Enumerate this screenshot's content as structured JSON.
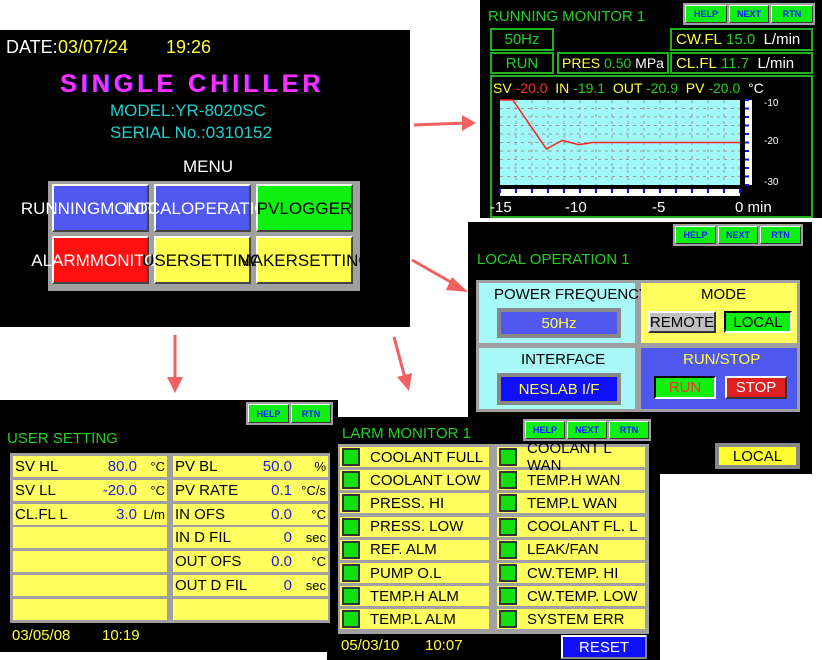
{
  "main_menu": {
    "date_label": "DATE:",
    "date": "03/07/24",
    "time": "19:26",
    "title": "SINGLE CHILLER",
    "model": "MODEL:YR-8020SC",
    "serial": "SERIAL No.:0310152",
    "menu_label": "MENU",
    "buttons": [
      {
        "l1": "RUNNING",
        "l2": "MONITOR",
        "color": "#5058f0"
      },
      {
        "l1": "LOCAL",
        "l2": "OPERATION",
        "color": "#5058f0"
      },
      {
        "l1": "PV",
        "l2": "LOGGER",
        "color": "#10f010"
      },
      {
        "l1": "ALARM",
        "l2": "MONITOR",
        "color": "#ff1010"
      },
      {
        "l1": "USER",
        "l2": "SETTING",
        "color": "#ffff50"
      },
      {
        "l1": "MAKER",
        "l2": "SETTING",
        "color": "#ffff50"
      }
    ]
  },
  "running_monitor": {
    "title": "RUNNING MONITOR 1",
    "help": "HELP",
    "next": "NEXT",
    "rtn": "RTN",
    "freq": "50Hz",
    "status": "RUN",
    "pres_label": "PRES",
    "pres_value": "0.50",
    "pres_unit": "MPa",
    "cwfl_label": "CW.FL",
    "cwfl_value": "15.0",
    "cwfl_unit": "L/min",
    "clfl_label": "CL.FL",
    "clfl_value": "11.7",
    "clfl_unit": "L/min",
    "sv_label": "SV",
    "sv": "-20.0",
    "in_label": "IN",
    "in": "-19.1",
    "out_label": "OUT",
    "out": "-20.9",
    "pv_label": "PV",
    "pv": "-20.0",
    "temp_unit": "°C"
  },
  "chart_data": {
    "type": "line",
    "x": [
      -15,
      -14.2,
      -12.1,
      -11.1,
      -10.1,
      -9.5,
      -9.3,
      0
    ],
    "y": [
      -10,
      -10,
      -21.5,
      -19.5,
      -20.5,
      -20.2,
      -20,
      -20
    ],
    "xlim": [
      -15,
      0
    ],
    "ylim": [
      -30,
      -10
    ],
    "xticks": [
      "-15",
      "-10",
      "-5",
      "0"
    ],
    "xunit": "min",
    "yticks": [
      "-10",
      "-20",
      "-30"
    ],
    "grid": true,
    "line_color": "#ff2020",
    "background": "#a0f8f8"
  },
  "local_operation": {
    "title": "LOCAL OPERATION 1",
    "help": "HELP",
    "next": "NEXT",
    "rtn": "RTN",
    "power_label": "POWER FREQUENCY",
    "power_value": "50Hz",
    "mode_label": "MODE",
    "remote": "REMOTE",
    "local": "LOCAL",
    "interface_label": "INTERFACE",
    "interface_value": "NESLAB I/F",
    "runstop_label": "RUN/STOP",
    "run": "RUN",
    "stop": "STOP",
    "local_indicator": "LOCAL"
  },
  "user_setting": {
    "title": "USER SETTING",
    "help": "HELP",
    "rtn": "RTN",
    "date": "03/05/08",
    "time": "10:19",
    "left": [
      {
        "label": "SV HL",
        "value": "80.0",
        "unit": "°C"
      },
      {
        "label": "SV LL",
        "value": "-20.0",
        "unit": "°C"
      },
      {
        "label": "CL.FL L",
        "value": "3.0",
        "unit": "L/m"
      },
      {
        "label": "",
        "value": "",
        "unit": ""
      },
      {
        "label": "",
        "value": "",
        "unit": ""
      },
      {
        "label": "",
        "value": "",
        "unit": ""
      },
      {
        "label": "",
        "value": "",
        "unit": ""
      }
    ],
    "right": [
      {
        "label": "PV BL",
        "value": "50.0",
        "unit": "%"
      },
      {
        "label": "PV RATE",
        "value": "0.1",
        "unit": "°C/s"
      },
      {
        "label": "IN OFS",
        "value": "0.0",
        "unit": "°C"
      },
      {
        "label": "IN D FIL",
        "value": "0",
        "unit": "sec"
      },
      {
        "label": "OUT OFS",
        "value": "0.0",
        "unit": "°C"
      },
      {
        "label": "OUT D FIL",
        "value": "0",
        "unit": "sec"
      },
      {
        "label": "",
        "value": "",
        "unit": ""
      }
    ]
  },
  "alarm_monitor": {
    "title": "LARM MONITOR 1",
    "help": "HELP",
    "next": "NEXT",
    "rtn": "RTN",
    "date": "05/03/10",
    "time": "10:07",
    "reset": "RESET",
    "left": [
      "COOLANT FULL",
      "COOLANT LOW",
      "PRESS. HI",
      "PRESS. LOW",
      "REF. ALM",
      "PUMP O.L",
      "TEMP.H ALM",
      "TEMP.L ALM"
    ],
    "right": [
      "COOLANT L WAN",
      "TEMP.H WAN",
      "TEMP.L WAN",
      "COOLANT FL. L",
      "LEAK/FAN",
      "CW.TEMP. HI",
      "CW.TEMP. LOW",
      "SYSTEM ERR"
    ]
  }
}
